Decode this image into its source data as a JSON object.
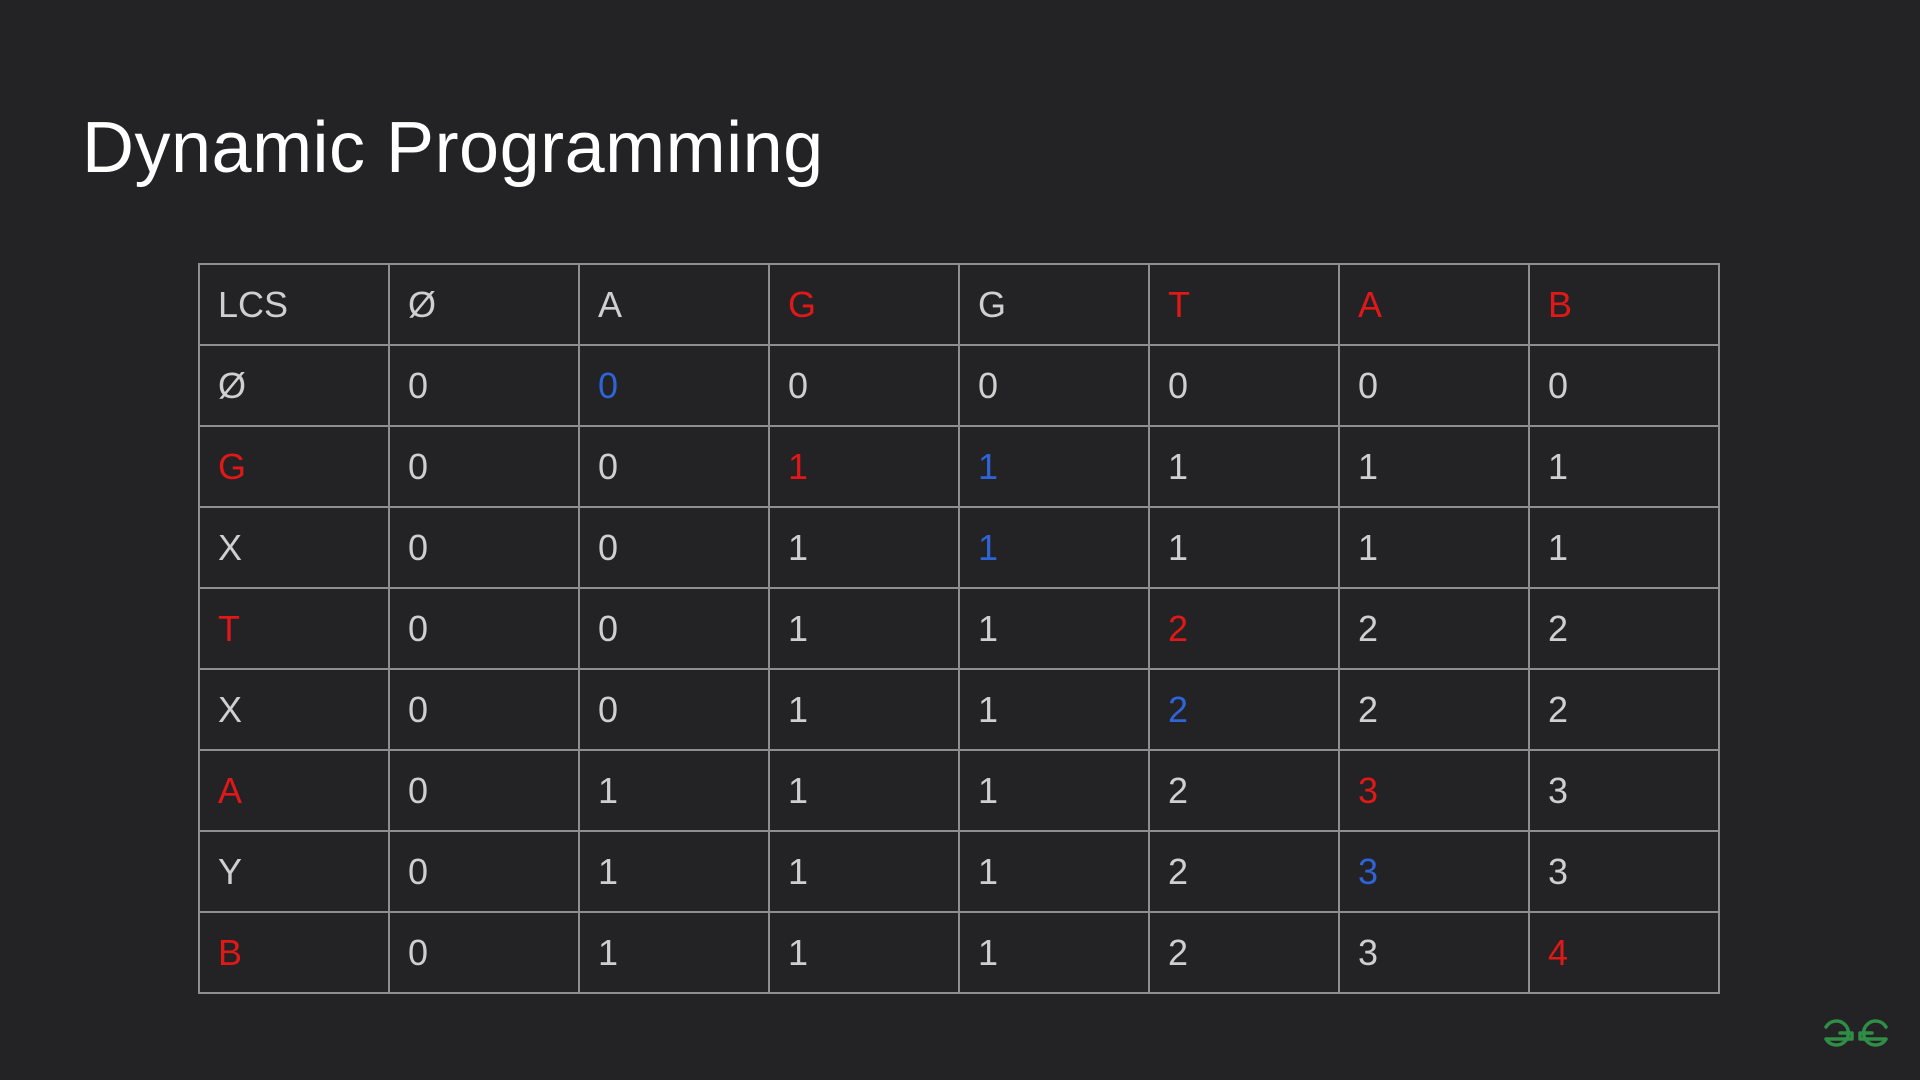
{
  "slide": {
    "title": "Dynamic Programming"
  },
  "colors": {
    "background": "#232325",
    "title": "#ffffff",
    "cell_text": "#cfcfcf",
    "grid": "#8e8e90",
    "highlight_red": "#e01818",
    "highlight_blue": "#2f63d8",
    "logo_green": "#2f8d46"
  },
  "table": {
    "rows": [
      [
        {
          "t": "LCS",
          "c": ""
        },
        {
          "t": "Ø",
          "c": ""
        },
        {
          "t": "A",
          "c": ""
        },
        {
          "t": "G",
          "c": "red"
        },
        {
          "t": "G",
          "c": ""
        },
        {
          "t": "T",
          "c": "red"
        },
        {
          "t": "A",
          "c": "red"
        },
        {
          "t": "B",
          "c": "red"
        }
      ],
      [
        {
          "t": "Ø",
          "c": ""
        },
        {
          "t": "0",
          "c": ""
        },
        {
          "t": "0",
          "c": "blue"
        },
        {
          "t": "0",
          "c": ""
        },
        {
          "t": "0",
          "c": ""
        },
        {
          "t": "0",
          "c": ""
        },
        {
          "t": "0",
          "c": ""
        },
        {
          "t": "0",
          "c": ""
        }
      ],
      [
        {
          "t": "G",
          "c": "red"
        },
        {
          "t": "0",
          "c": ""
        },
        {
          "t": "0",
          "c": ""
        },
        {
          "t": "1",
          "c": "red"
        },
        {
          "t": "1",
          "c": "blue"
        },
        {
          "t": "1",
          "c": ""
        },
        {
          "t": "1",
          "c": ""
        },
        {
          "t": "1",
          "c": ""
        }
      ],
      [
        {
          "t": "X",
          "c": ""
        },
        {
          "t": "0",
          "c": ""
        },
        {
          "t": "0",
          "c": ""
        },
        {
          "t": "1",
          "c": ""
        },
        {
          "t": "1",
          "c": "blue"
        },
        {
          "t": "1",
          "c": ""
        },
        {
          "t": "1",
          "c": ""
        },
        {
          "t": "1",
          "c": ""
        }
      ],
      [
        {
          "t": "T",
          "c": "red"
        },
        {
          "t": "0",
          "c": ""
        },
        {
          "t": "0",
          "c": ""
        },
        {
          "t": "1",
          "c": ""
        },
        {
          "t": "1",
          "c": ""
        },
        {
          "t": "2",
          "c": "red"
        },
        {
          "t": "2",
          "c": ""
        },
        {
          "t": "2",
          "c": ""
        }
      ],
      [
        {
          "t": "X",
          "c": ""
        },
        {
          "t": "0",
          "c": ""
        },
        {
          "t": "0",
          "c": ""
        },
        {
          "t": "1",
          "c": ""
        },
        {
          "t": "1",
          "c": ""
        },
        {
          "t": "2",
          "c": "blue"
        },
        {
          "t": "2",
          "c": ""
        },
        {
          "t": "2",
          "c": ""
        }
      ],
      [
        {
          "t": "A",
          "c": "red"
        },
        {
          "t": "0",
          "c": ""
        },
        {
          "t": "1",
          "c": ""
        },
        {
          "t": "1",
          "c": ""
        },
        {
          "t": "1",
          "c": ""
        },
        {
          "t": "2",
          "c": ""
        },
        {
          "t": "3",
          "c": "red"
        },
        {
          "t": "3",
          "c": ""
        }
      ],
      [
        {
          "t": "Y",
          "c": ""
        },
        {
          "t": "0",
          "c": ""
        },
        {
          "t": "1",
          "c": ""
        },
        {
          "t": "1",
          "c": ""
        },
        {
          "t": "1",
          "c": ""
        },
        {
          "t": "2",
          "c": ""
        },
        {
          "t": "3",
          "c": "blue"
        },
        {
          "t": "3",
          "c": ""
        }
      ],
      [
        {
          "t": "B",
          "c": "red"
        },
        {
          "t": "0",
          "c": ""
        },
        {
          "t": "1",
          "c": ""
        },
        {
          "t": "1",
          "c": ""
        },
        {
          "t": "1",
          "c": ""
        },
        {
          "t": "2",
          "c": ""
        },
        {
          "t": "3",
          "c": ""
        },
        {
          "t": "4",
          "c": "red"
        }
      ]
    ]
  },
  "logo": {
    "icon": "geeksforgeeks-logo-icon"
  }
}
